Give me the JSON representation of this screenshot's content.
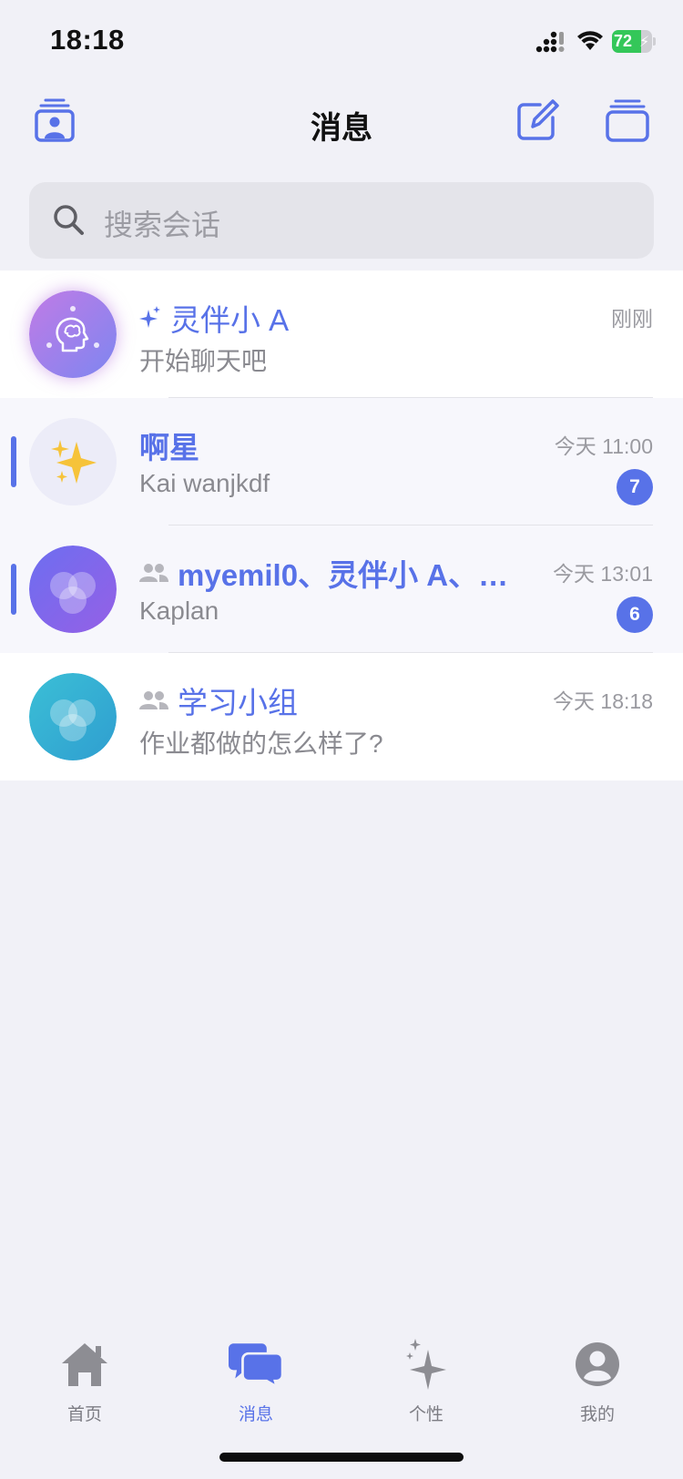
{
  "status_bar": {
    "time": "18:18",
    "battery": "72",
    "battery_level": 0.72
  },
  "header": {
    "title": "消息"
  },
  "search": {
    "placeholder": "搜索会话"
  },
  "conversations": [
    {
      "title": "灵伴小 A",
      "time": "刚刚",
      "preview": "开始聊天吧",
      "badge": "",
      "icon": "sparkle-icon"
    },
    {
      "title": "啊星",
      "time": "今天 11:00",
      "preview": "Kai wanjkdf",
      "badge": "7",
      "icon": ""
    },
    {
      "title": "myemil0、灵伴小 A、…",
      "time": "今天 13:01",
      "preview": "Kaplan",
      "badge": "6",
      "icon": "group-icon"
    },
    {
      "title": "学习小组",
      "time": "今天 18:18",
      "preview": "作业都做的怎么样了?",
      "badge": "",
      "icon": "group-icon"
    }
  ],
  "tabs": [
    {
      "label": "首页",
      "icon": "home-icon"
    },
    {
      "label": "消息",
      "icon": "chat-bubbles-icon",
      "active": true
    },
    {
      "label": "个性",
      "icon": "sparkle-icon"
    },
    {
      "label": "我的",
      "icon": "profile-icon"
    }
  ],
  "colors": {
    "accent": "#5872e8",
    "background": "#f1f1f7",
    "battery_green": "#34c759"
  }
}
